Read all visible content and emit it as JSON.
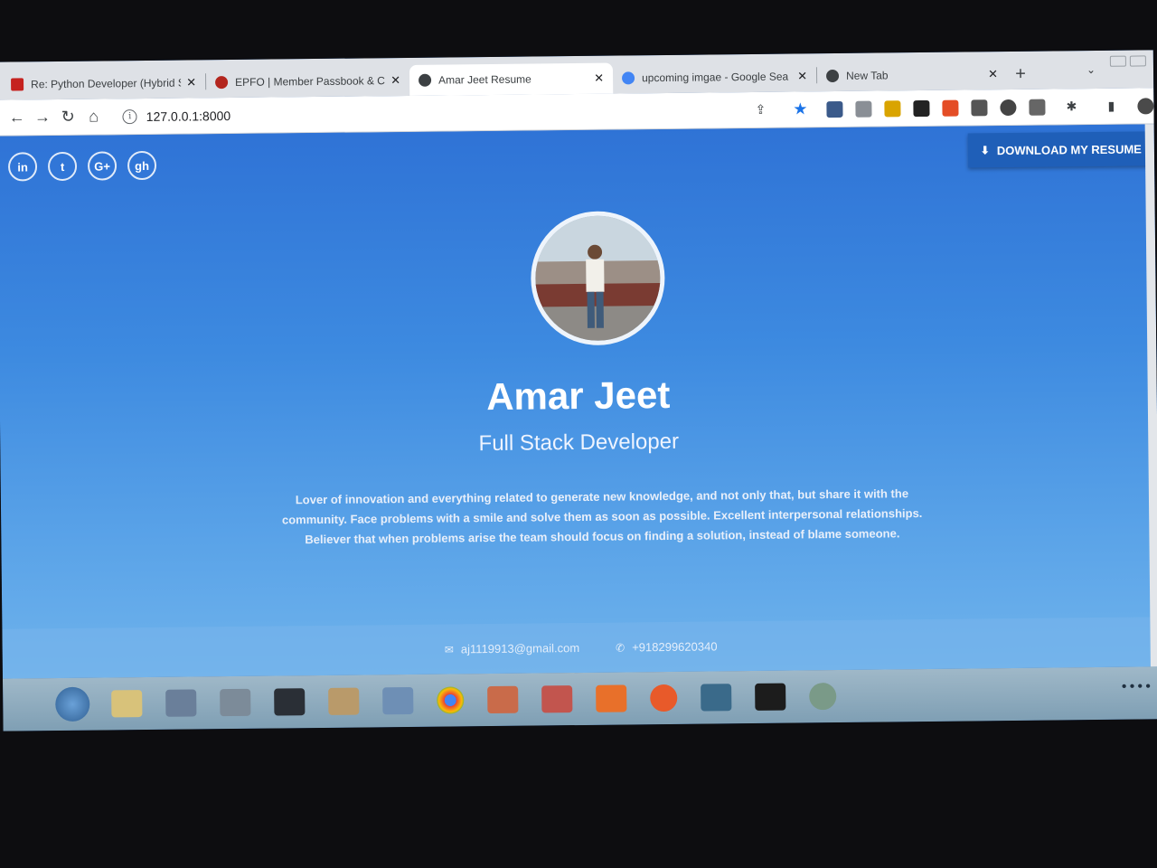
{
  "browser": {
    "tabs": [
      {
        "title": "Re: Python Developer (Hybrid S",
        "favicon_color": "#c5221f",
        "active": false
      },
      {
        "title": "EPFO | Member Passbook & Cl",
        "favicon_color": "#b3261e",
        "active": false
      },
      {
        "title": "Amar Jeet Resume",
        "favicon_color": "#3c4043",
        "active": true
      },
      {
        "title": "upcoming imgae - Google Sea",
        "favicon_color": "#4285f4",
        "active": false
      },
      {
        "title": "New Tab",
        "favicon_color": "#3c4043",
        "active": false
      }
    ],
    "new_tab_label": "+",
    "close_label": "✕",
    "url": "127.0.0.1:8000"
  },
  "page": {
    "socials": [
      {
        "label": "in",
        "icon": "linkedin-icon"
      },
      {
        "label": "t",
        "icon": "twitter-icon"
      },
      {
        "label": "G+",
        "icon": "google-plus-icon"
      },
      {
        "label": "gh",
        "icon": "github-icon"
      }
    ],
    "download_label": "DOWNLOAD MY RESUME",
    "name": "Amar Jeet",
    "job_title": "Full Stack Developer",
    "bio": "Lover of innovation and everything related to generate new knowledge, and not only that, but share it with the community. Face problems with a smile and solve them as soon as possible. Excellent interpersonal relationships. Believer that when problems arise the team should focus on finding a solution, instead of blame someone.",
    "email": "aj1119913@gmail.com",
    "phone": "+918299620340"
  },
  "colors": {
    "accent": "#1f5fb8",
    "page_top": "#2f73d6",
    "page_bottom": "#6fb3ec"
  }
}
